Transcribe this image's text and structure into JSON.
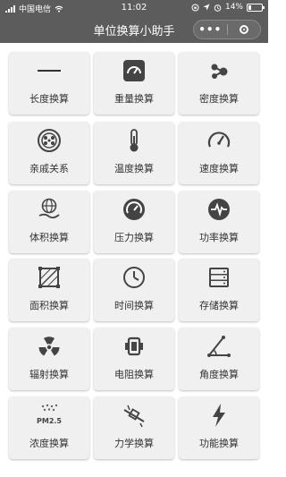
{
  "status_bar": {
    "carrier": "中国电信",
    "time": "11:02",
    "battery": "14%"
  },
  "nav": {
    "title": "单位换算小助手",
    "more": "•••"
  },
  "tiles": [
    {
      "label": "长度换算",
      "icon": "ruler-line-icon"
    },
    {
      "label": "重量换算",
      "icon": "scale-gauge-icon"
    },
    {
      "label": "密度换算",
      "icon": "molecule-icon"
    },
    {
      "label": "亲戚关系",
      "icon": "family-tree-icon"
    },
    {
      "label": "温度换算",
      "icon": "thermometer-icon"
    },
    {
      "label": "速度换算",
      "icon": "speedometer-icon"
    },
    {
      "label": "体积换算",
      "icon": "globe-hand-icon"
    },
    {
      "label": "压力换算",
      "icon": "pressure-gauge-icon"
    },
    {
      "label": "功率换算",
      "icon": "power-wave-icon"
    },
    {
      "label": "面积换算",
      "icon": "area-square-icon"
    },
    {
      "label": "时间换算",
      "icon": "clock-icon"
    },
    {
      "label": "存储换算",
      "icon": "storage-server-icon"
    },
    {
      "label": "辐射换算",
      "icon": "radiation-icon"
    },
    {
      "label": "电阻换算",
      "icon": "resistor-icon"
    },
    {
      "label": "角度换算",
      "icon": "angle-icon"
    },
    {
      "label": "浓度换算",
      "icon": "pm25-icon",
      "icon_text": "PM2.5"
    },
    {
      "label": "力学换算",
      "icon": "mechanics-icon"
    },
    {
      "label": "功能换算",
      "icon": "lightning-icon"
    }
  ]
}
